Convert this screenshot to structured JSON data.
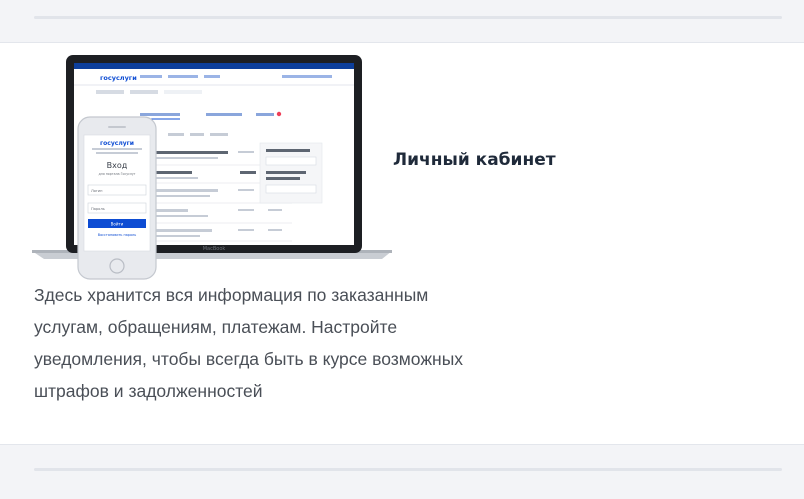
{
  "card": {
    "title": "Личный кабинет",
    "description": "Здесь хранится вся информация по заказанным услугам, обращениям, платежам. Настройте уведомления, чтобы всегда быть в курсе возможных штрафов и задолженностей"
  },
  "illustration": {
    "laptop_brand": "MacBook",
    "site_logo": "госуслуги",
    "phone_login_heading": "Вход",
    "phone_login_sub": "для портала Госуслуг",
    "phone_field_login": "Логин",
    "phone_field_password": "Пароль",
    "phone_login_button": "Войти",
    "phone_forgot_link": "Восстановить пароль"
  },
  "colors": {
    "page_bg": "#f3f4f7",
    "card_bg": "#ffffff",
    "divider": "#e1e4ea",
    "title": "#1f2a3a",
    "text": "#4a4f57",
    "brand_blue": "#0d4cd3",
    "brand_red": "#ee3f58"
  },
  "icons": [
    "laptop-icon",
    "phone-icon"
  ]
}
